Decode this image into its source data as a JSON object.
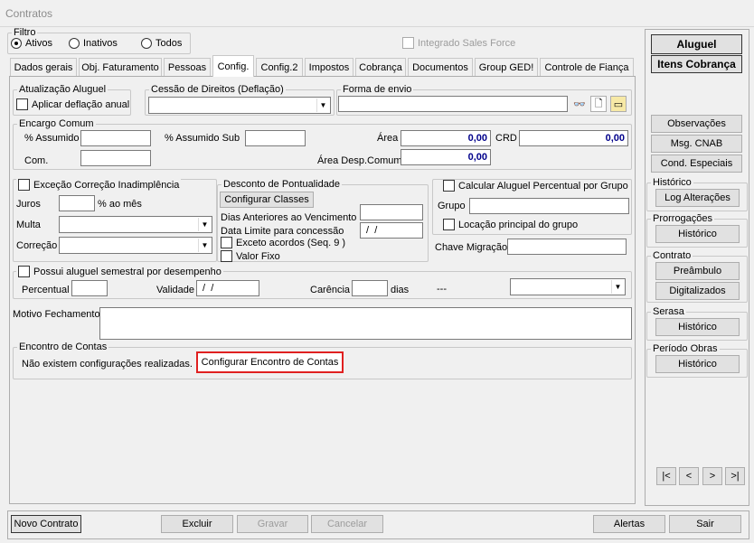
{
  "window": {
    "title": "Contratos"
  },
  "filtro": {
    "legend": "Filtro",
    "options": [
      "Ativos",
      "Inativos",
      "Todos"
    ],
    "selected": "Ativos"
  },
  "integrado": {
    "label": "Integrado Sales Force"
  },
  "tabs": [
    "Dados gerais",
    "Obj. Faturamento",
    "Pessoas",
    "Config.",
    "Config.2",
    "Impostos",
    "Cobrança",
    "Documentos",
    "Group GED!",
    "Controle de Fiança"
  ],
  "active_tab": "Config.",
  "atualizacao": {
    "legend": "Atualização Aluguel",
    "checkbox": "Aplicar deflação anual"
  },
  "cessao": {
    "legend": "Cessão de Direitos (Deflação)",
    "value": ""
  },
  "forma_envio": {
    "legend": "Forma de envio",
    "value": ""
  },
  "encargo": {
    "legend": "Encargo Comum",
    "assumido_label": "% Assumido",
    "assumido": "",
    "assumido_sub_label": "% Assumido Sub",
    "assumido_sub": "",
    "area_label": "Área",
    "area": "0,00",
    "crd_label": "CRD",
    "crd": "0,00",
    "com_label": "Com.",
    "com": "",
    "area_desp_label": "Área Desp.Comum",
    "area_desp": "0,00"
  },
  "excecao": {
    "legend": "Exceção Correção Inadimplência",
    "juros_label": "Juros",
    "juros_suffix": "% ao mês",
    "juros": "",
    "multa_label": "Multa",
    "correcao_label": "Correção"
  },
  "desconto": {
    "legend": "Desconto de Pontualidade",
    "config_btn": "Configurar Classes",
    "dias_label": "Dias Anteriores ao Vencimento",
    "dias": "",
    "data_label": "Data Limite para concessão",
    "data": " /  /",
    "exceto": "Exceto acordos (Seq. 9 )",
    "valor_fixo": "Valor Fixo"
  },
  "calcular": {
    "legend": "Calcular Aluguel Percentual por Grupo",
    "grupo_label": "Grupo",
    "grupo": "",
    "locacao": "Locação principal do grupo",
    "chave_label": "Chave Migração",
    "chave": ""
  },
  "semestral": {
    "legend": "Possui aluguel semestral por desempenho",
    "percentual_label": "Percentual",
    "percentual": "",
    "validade_label": "Validade",
    "validade": " /  /",
    "carencia_label": "Carência",
    "carencia": "",
    "dias_label": "dias",
    "dash": "---"
  },
  "motivo": {
    "label": "Motivo Fechamento",
    "value": ""
  },
  "encontro": {
    "legend": "Encontro de Contas",
    "text": "Não existem configurações realizadas.",
    "button": "Configurar Encontro de Contas"
  },
  "right": {
    "aluguel": "Aluguel",
    "itens": "Itens Cobrança",
    "observacoes": "Observações",
    "msg_cnab": "Msg. CNAB",
    "cond_especiais": "Cond. Especiais",
    "historico_legend": "Histórico",
    "log": "Log Alterações",
    "prorrogacoes_legend": "Prorrogações",
    "prorrogacoes_btn": "Histórico",
    "contrato_legend": "Contrato",
    "preambulo": "Preâmbulo",
    "digitalizados": "Digitalizados",
    "serasa_legend": "Serasa",
    "serasa_btn": "Histórico",
    "periodo_legend": "Período Obras",
    "periodo_btn": "Histórico"
  },
  "nav": [
    "|<",
    "<",
    ">",
    ">|"
  ],
  "bottom": {
    "novo": "Novo Contrato",
    "excluir": "Excluir",
    "gravar": "Gravar",
    "cancelar": "Cancelar",
    "alertas": "Alertas",
    "sair": "Sair"
  },
  "colors": {
    "highlight": "#e02020",
    "num": "#00008b"
  }
}
